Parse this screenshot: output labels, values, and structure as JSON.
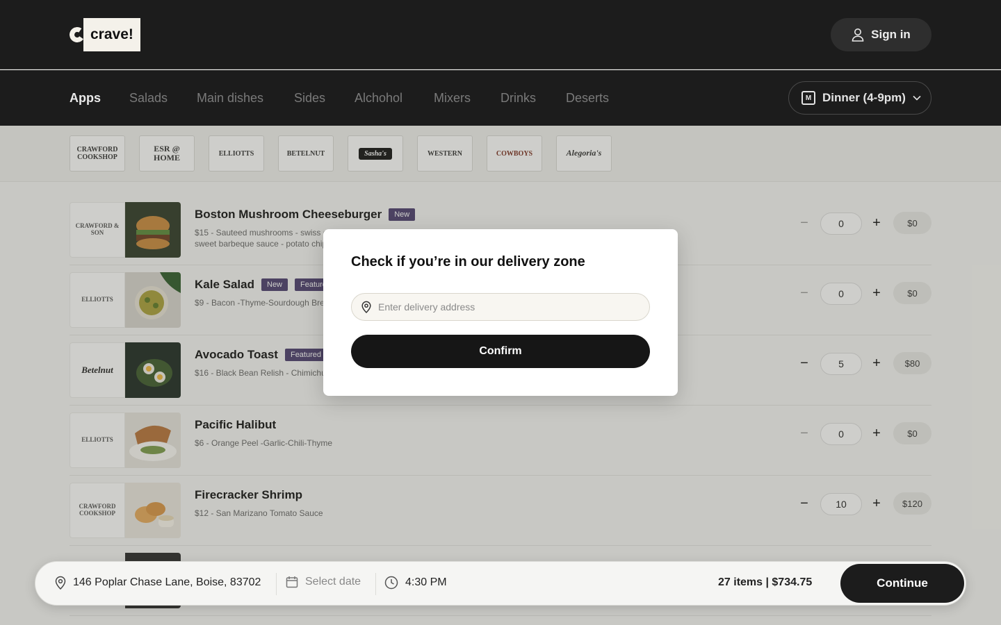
{
  "header": {
    "logo_text": "crave!",
    "signin_label": "Sign in"
  },
  "categories": [
    "Apps",
    "Salads",
    "Main dishes",
    "Sides",
    "Alchohol",
    "Mixers",
    "Drinks",
    "Deserts"
  ],
  "active_category": "Apps",
  "meal_period": {
    "label": "Dinner (4-9pm)",
    "icon": "menu-card-icon"
  },
  "brands": [
    {
      "name": "Crawford Cookshop",
      "text": "CRAWFORD COOKSHOP"
    },
    {
      "name": "ESR @ Home",
      "text": "ESR @ HOME"
    },
    {
      "name": "Elliott's",
      "text": "ELLIOTTS"
    },
    {
      "name": "Betelnut",
      "text": "BETELNUT"
    },
    {
      "name": "Sasha's",
      "text": "Sasha's"
    },
    {
      "name": "Western",
      "text": "WESTERN"
    },
    {
      "name": "Cowboys",
      "text": "COWBOYS"
    },
    {
      "name": "Alegoria's",
      "text": "Alegoria's"
    }
  ],
  "items": [
    {
      "name": "Boston Mushroom Cheeseburger",
      "badges": [
        "New"
      ],
      "brand": "CRAWFORD & SON",
      "desc": "$15 - Sauteed mushrooms - swiss c",
      "desc2": "sweet barbeque sauce - potato chip",
      "qty": "0",
      "price": "$0",
      "photo": "burger"
    },
    {
      "name": "Kale Salad",
      "badges": [
        "New",
        "Featured"
      ],
      "brand": "ELLIOTTS",
      "desc": "$9 - Bacon -Thyme-Sourdough Brea",
      "desc2": "",
      "qty": "0",
      "price": "$0",
      "photo": "salad"
    },
    {
      "name": "Avocado Toast",
      "badges": [
        "Featured"
      ],
      "brand": "Betelnut",
      "desc": "$16 - Black Bean Relish - Chimichur",
      "desc2": "",
      "qty": "5",
      "price": "$80",
      "photo": "toast"
    },
    {
      "name": "Pacific Halibut",
      "badges": [],
      "brand": "ELLIOTTS",
      "desc": "$6 - Orange Peel -Garlic-Chili-Thyme",
      "desc2": "",
      "qty": "0",
      "price": "$0",
      "photo": "halibut"
    },
    {
      "name": "Firecracker Shrimp",
      "badges": [],
      "brand": "CRAWFORD COOKSHOP",
      "desc": "$12 - San Marizano Tomato Sauce",
      "desc2": "",
      "qty": "10",
      "price": "$120",
      "photo": "shrimp"
    }
  ],
  "bottom_bar": {
    "address": "146  Poplar Chase Lane,  Boise, 83702",
    "date_placeholder": "Select date",
    "time": "4:30 PM",
    "summary": "27 items | $734.75",
    "continue_label": "Continue"
  },
  "modal": {
    "title": "Check if you’re in our delivery zone",
    "input_placeholder": "Enter delivery address",
    "input_value": "",
    "confirm_label": "Confirm"
  },
  "colors": {
    "header_bg": "#1c1c1c",
    "badge_bg": "#4b3e6e",
    "button_dark": "#161616",
    "page_bg": "#f7f7f5"
  }
}
